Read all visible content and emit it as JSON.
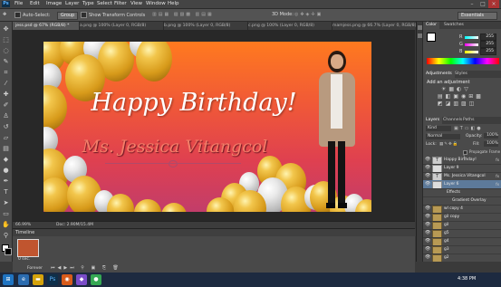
{
  "app": {
    "logo": "Ps"
  },
  "menu": [
    "File",
    "Edit",
    "Image",
    "Layer",
    "Type",
    "Select",
    "Filter",
    "View",
    "Window",
    "Help"
  ],
  "window_controls": [
    "–",
    "□",
    "×"
  ],
  "options_bar": {
    "auto_select_label": "Auto-Select:",
    "auto_select_value": "Group",
    "transform_label": "Show Transform Controls",
    "mode_3d_label": "3D Mode:",
    "workspace": "Essentials"
  },
  "tabs": [
    {
      "label": "jess.psd @ 67% (RGB/8) *",
      "active": true
    },
    {
      "label": "a.png @ 100% (Layer 0, RGB/8)",
      "active": false
    },
    {
      "label": "b.png @ 100% (Layer 0, RGB/8)",
      "active": false
    },
    {
      "label": "c.png @ 100% (Layer 0, RGB/8)",
      "active": false
    },
    {
      "label": "mamjess.png @ 66.7% (Layer 0, RGB/8)",
      "active": false
    }
  ],
  "canvas": {
    "title_line1": "Happy Birthday!",
    "title_line2": "Ms. Jessica Vitangcol"
  },
  "status": {
    "zoom": "66.99%",
    "doc": "Doc: 2.90M/15.4M"
  },
  "timeline": {
    "title": "Timeline",
    "frame_time": "0 sec.",
    "loop": "Forever"
  },
  "color_panel": {
    "tabs": [
      "Color",
      "Swatches"
    ],
    "r_label": "R",
    "r_value": "255",
    "g_label": "G",
    "g_value": "255",
    "b_label": "B",
    "b_value": "255"
  },
  "adjustments_panel": {
    "tabs": [
      "Adjustments",
      "Styles"
    ],
    "heading": "Add an adjustment"
  },
  "layers_panel": {
    "tabs": [
      "Layers",
      "Channels",
      "Paths"
    ],
    "kind_label": "Kind",
    "blend_mode": "Normal",
    "opacity_label": "Opacity:",
    "opacity_value": "100%",
    "lock_label": "Lock:",
    "fill_label": "Fill:",
    "fill_value": "100%",
    "propagate_label": "Propagate Frame 1",
    "layers": [
      {
        "name": "Happy Birthday!",
        "type": "text",
        "fx": "fx",
        "selected": false
      },
      {
        "name": "Layer 9",
        "type": "image",
        "fx": "",
        "selected": false
      },
      {
        "name": "Ms. Jessica Vitangcol",
        "type": "text",
        "fx": "fx",
        "selected": false
      },
      {
        "name": "Layer 6",
        "type": "image",
        "fx": "fx",
        "selected": true
      },
      {
        "name": "Effects",
        "type": "effect",
        "fx": "",
        "selected": false
      },
      {
        "name": "Gradient Overlay",
        "type": "effect",
        "fx": "",
        "selected": false
      },
      {
        "name": "wl copy 4",
        "type": "folder",
        "fx": "",
        "selected": false
      },
      {
        "name": "gil copy",
        "type": "folder",
        "fx": "",
        "selected": false
      },
      {
        "name": "gil",
        "type": "folder",
        "fx": "",
        "selected": false
      },
      {
        "name": "g5",
        "type": "folder",
        "fx": "",
        "selected": false
      },
      {
        "name": "g4",
        "type": "folder",
        "fx": "",
        "selected": false
      },
      {
        "name": "g3",
        "type": "folder",
        "fx": "",
        "selected": false
      },
      {
        "name": "g2",
        "type": "folder",
        "fx": "",
        "selected": false
      }
    ]
  },
  "taskbar": {
    "time": "4:38 PM"
  },
  "colors": {
    "accent": "#5d7a9a",
    "panel": "#4a4a4a",
    "canvas_top": "#ff7a1f",
    "canvas_bottom": "#c23d6a"
  }
}
